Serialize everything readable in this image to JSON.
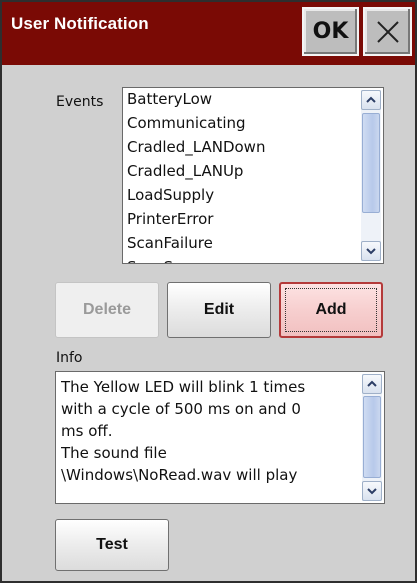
{
  "window": {
    "title": "User Notification",
    "ok_label": "OK",
    "close_icon": "close-icon"
  },
  "events": {
    "label": "Events",
    "items": [
      "BatteryLow",
      "Communicating",
      "Cradled_LANDown",
      "Cradled_LANUp",
      "LoadSupply",
      "PrinterError",
      "ScanFailure",
      "ScanSuccess"
    ]
  },
  "buttons": {
    "delete": "Delete",
    "edit": "Edit",
    "add": "Add",
    "test": "Test"
  },
  "info": {
    "label": "Info",
    "text": "The Yellow LED will blink 1 times\nwith a cycle of 500 ms on and 0\nms off.\nThe sound file\n\\Windows\\NoRead.wav will play"
  },
  "colors": {
    "titlebar": "#7a0a05",
    "background": "#d0d0d0",
    "add_button": "#f7cfcf"
  }
}
